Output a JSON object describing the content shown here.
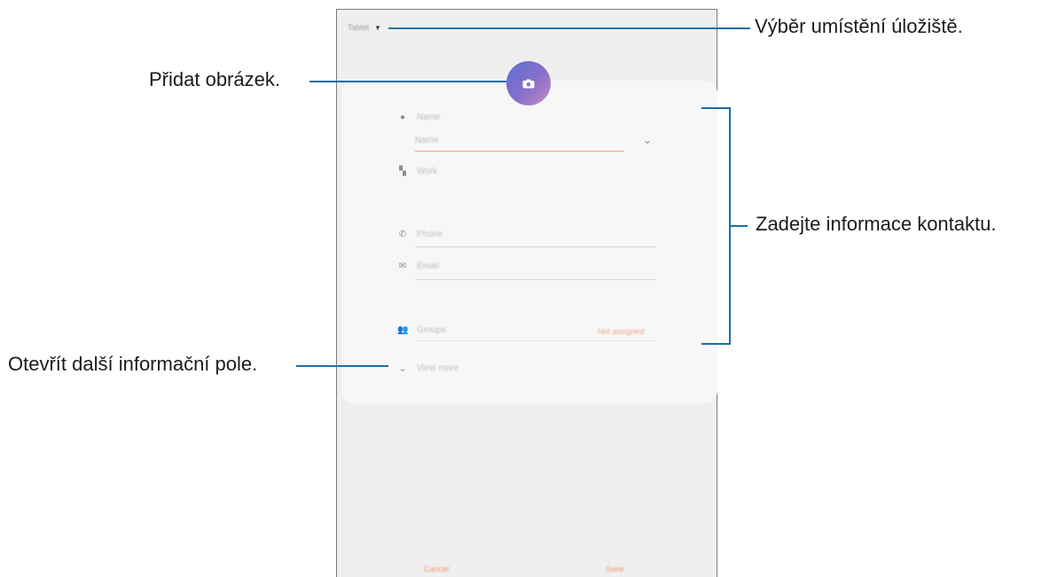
{
  "annotations": {
    "storage": "Výběr umístění úložiště.",
    "picture": "Přidat obrázek.",
    "details": "Zadejte informace kontaktu.",
    "more": "Otevřít další informační pole."
  },
  "screen": {
    "storage_label": "Tablet",
    "icons": {
      "camera": "camera-icon",
      "name": "person-icon",
      "work": "building-icon",
      "phone": "phone-icon",
      "email": "mail-icon",
      "groups": "group-icon",
      "expand": "chevron-down-icon"
    },
    "fields": {
      "name_label": "Name",
      "name_placeholder": "Name",
      "work_label": "Work",
      "phone_placeholder": "Phone",
      "email_placeholder": "Email",
      "groups_label": "Groups",
      "groups_value": "Not assigned"
    },
    "view_more": "View more",
    "cancel": "Cancel",
    "save": "Save"
  },
  "colors": {
    "accent": "#f09a78",
    "callout_line": "#1b6ea8",
    "avatar_start": "#5b6fd6",
    "avatar_end": "#c48fc6"
  }
}
